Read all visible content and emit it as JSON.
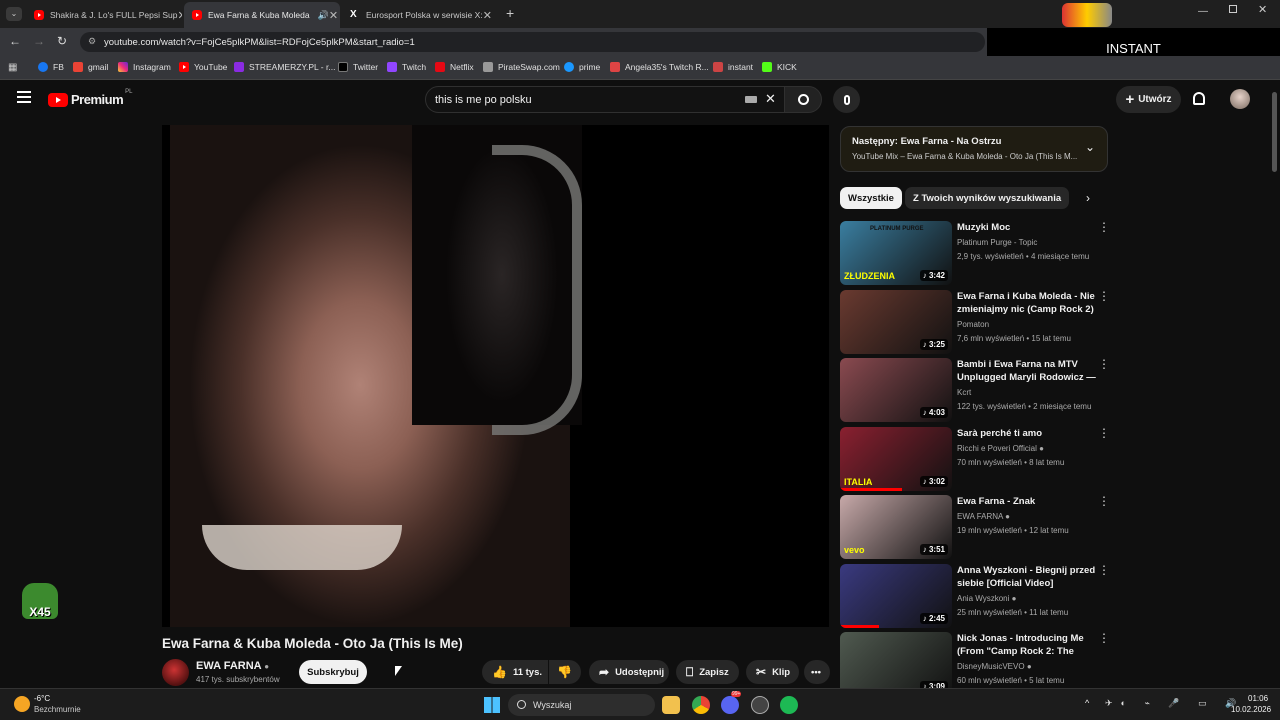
{
  "browser": {
    "tabs": [
      {
        "title": "Shakira & J. Lo's FULL Pepsi Sup",
        "active": false
      },
      {
        "title": "Ewa Farna & Kuba Moleda",
        "active": true
      },
      {
        "title": "Eurosport Polska w serwisie X:",
        "active": false
      }
    ],
    "new_tab": "+",
    "url": "youtube.com/watch?v=FojCe5plkPM&list=RDFojCe5plkPM&start_radio=1",
    "bookmarks": [
      "FB",
      "gmail",
      "Instagram",
      "YouTube",
      "STREAMERZY.PL - r...",
      "Twitter",
      "Twitch",
      "Netflix",
      "PirateSwap.com",
      "prime",
      "Angela35's Twitch R...",
      "instant",
      "KICK"
    ],
    "overlay": "INSTANT"
  },
  "youtube": {
    "logo": "Premium",
    "logo_region": "PL",
    "search_query": "this is me po polsku",
    "create_label": "Utwórz",
    "video_title": "Ewa Farna & Kuba Moleda - Oto Ja (This Is Me)",
    "channel_name": "EWA FARNA",
    "channel_subs": "417 tys. subskrybentów",
    "subscribe_label": "Subskrybuj",
    "like_count": "11 tys.",
    "share_label": "Udostępnij",
    "save_label": "Zapisz",
    "clip_label": "Klip",
    "up_next_title": "Następny: Ewa Farna - Na Ostrzu",
    "up_next_sub": "YouTube Mix – Ewa Farna & Kuba Moleda - Oto Ja (This Is M...",
    "chips": [
      "Wszystkie",
      "Z Twoich wyników wyszukiwania"
    ],
    "recommendations": [
      {
        "title": "Muzyki Moc",
        "channel": "Platinum Purge - Topic",
        "meta": "2,9 tys. wyświetleń • 4 miesiące temu",
        "duration": "3:42",
        "thumb_text_top": "PLATINUM PURGE",
        "thumb_text_bottom": "ZŁUDZENIA",
        "color": "#3a7ea0",
        "verified": false,
        "progress": 0
      },
      {
        "title": "Ewa Farna i Kuba Moleda - Nie zmieniajmy nic (Camp Rock 2)",
        "channel": "Pomaton",
        "meta": "7,6 mln wyświetleń • 15 lat temu",
        "duration": "3:25",
        "color": "#6a3a30",
        "verified": false,
        "progress": 0
      },
      {
        "title": "Bambi i Ewa Farna na MTV Unplugged Maryli Rodowicz — ...",
        "channel": "Kcrt",
        "meta": "122 tys. wyświetleń • 2 miesiące temu",
        "duration": "4:03",
        "color": "#8a4a50",
        "verified": false,
        "progress": 0
      },
      {
        "title": "Sarà perché ti amo",
        "channel": "Ricchi e Poveri Official",
        "meta": "70 mln wyświetleń • 8 lat temu",
        "duration": "3:02",
        "color": "#8a2030",
        "thumb_text_bottom": "ITALIA",
        "verified": true,
        "progress": 0.55
      },
      {
        "title": "Ewa Farna - Znak",
        "channel": "EWA FARNA",
        "meta": "19 mln wyświetleń • 12 lat temu",
        "duration": "3:51",
        "color": "#c7a9a9",
        "thumb_text_bottom": "vevo",
        "verified": true,
        "progress": 0
      },
      {
        "title": "Anna Wyszkoni - Biegnij przed siebie [Official Video]",
        "channel": "Ania Wyszkoni",
        "meta": "25 mln wyświetleń • 11 lat temu",
        "duration": "2:45",
        "color": "#3a3a80",
        "verified": true,
        "progress": 0.35
      },
      {
        "title": "Nick Jonas - Introducing Me (From \"Camp Rock 2: The Fina...",
        "channel": "DisneyMusicVEVO",
        "meta": "60 mln wyświetleń • 5 lat temu",
        "duration": "3:09",
        "color": "#505a50",
        "verified": true,
        "progress": 0
      }
    ]
  },
  "taskbar": {
    "weather_temp": "-6°C",
    "weather_desc": "Bezchmurnie",
    "search_placeholder": "Wyszukaj",
    "time": "01:06",
    "date": "10.02.2026",
    "discord_badge": "99+"
  },
  "overlay_badge": "X45"
}
